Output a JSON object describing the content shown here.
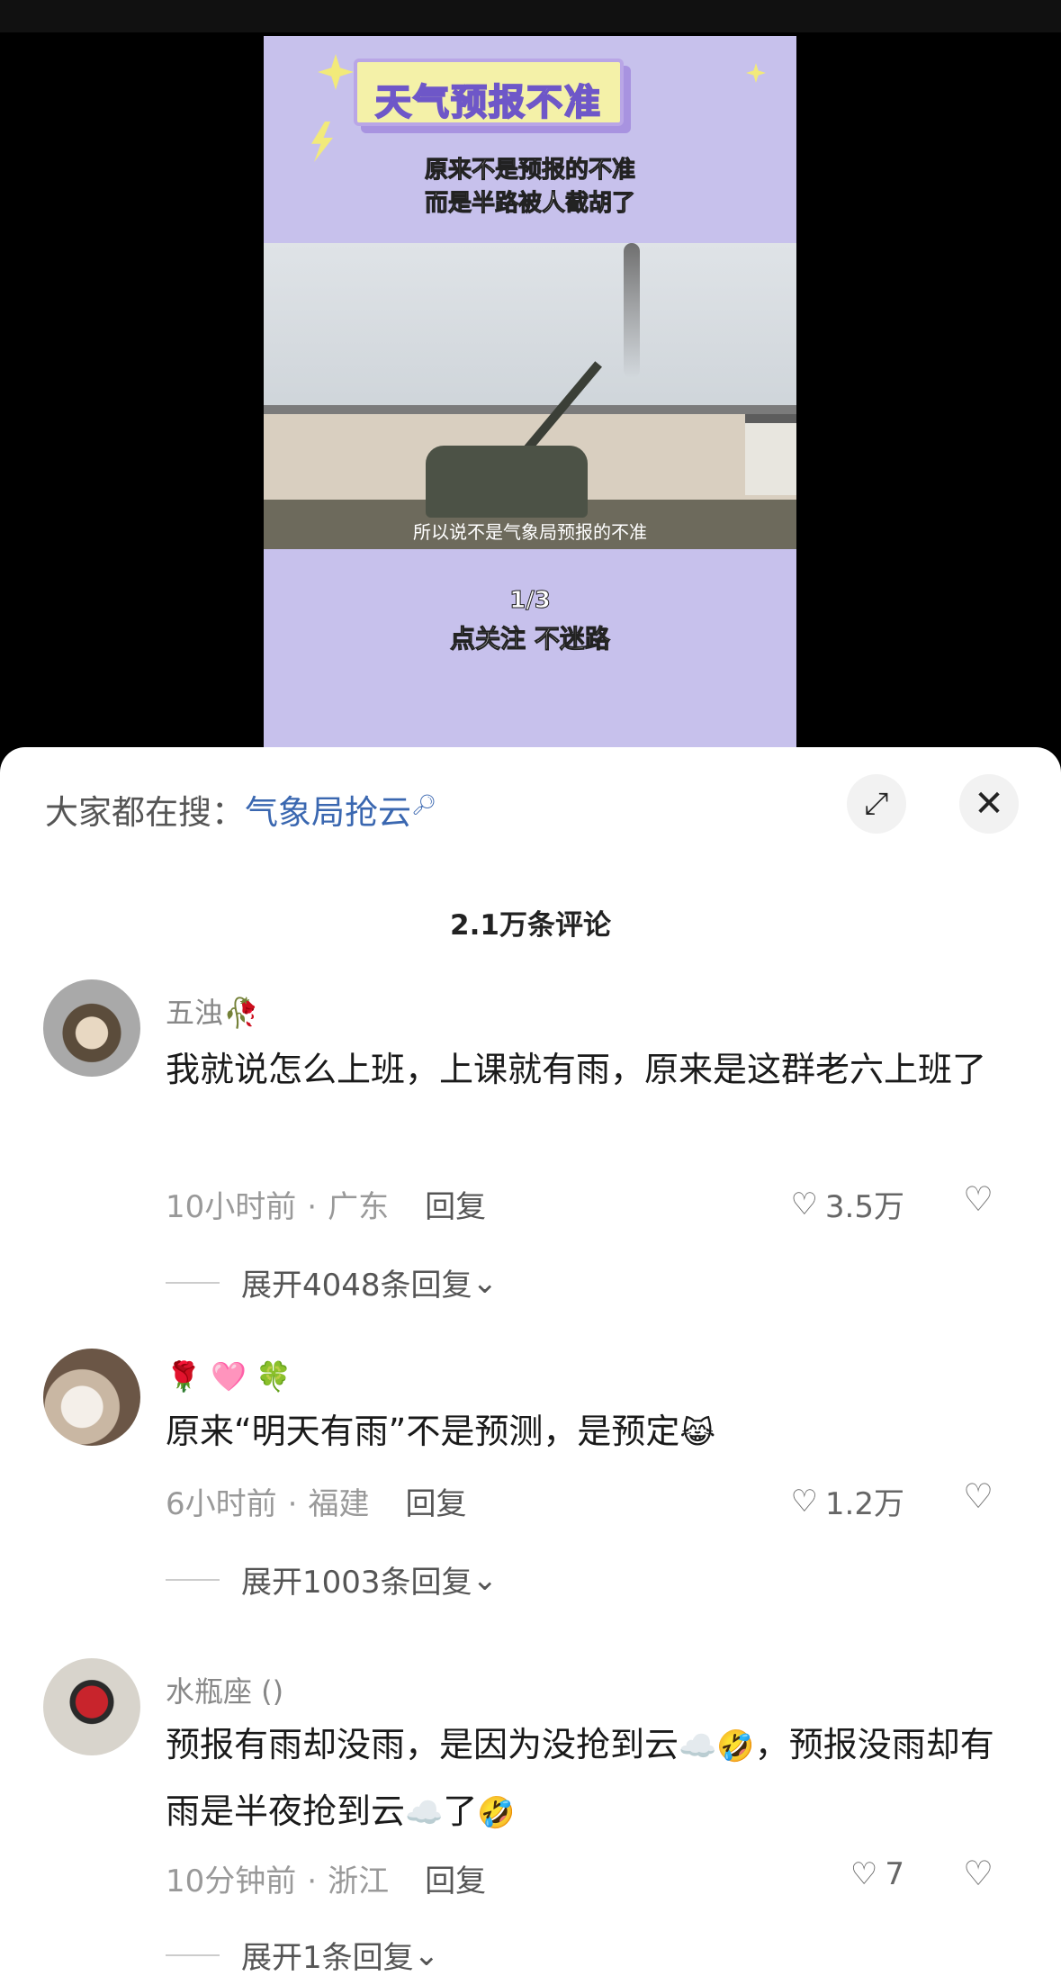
{
  "video": {
    "banner_title": "天气预报不准",
    "subtitle_line1": "原来不是预报的不准",
    "subtitle_line2": "而是半路被人截胡了",
    "caption": "所以说不是气象局预报的不准",
    "page_counter": "1/3",
    "follow_text": "点关注 不迷路"
  },
  "sheet": {
    "search_prefix": "大家都在搜：",
    "search_term": "气象局抢云",
    "search_icon": "search-icon",
    "comment_count": "2.1万条评论",
    "expand_icon": "expand-icon",
    "close_icon": "close-icon"
  },
  "comments": [
    {
      "name": "五浊",
      "name_icon": "flower-icon",
      "text": "我就说怎么上班，上课就有雨，原来是这群老六上班了",
      "time": "10小时前",
      "location": "广东",
      "reply_label": "回复",
      "likes": "3.5万",
      "expand_label": "展开4048条回复"
    },
    {
      "name": "🌹 🩷 🍀",
      "text": "原来“明天有雨”不是预测，是预定",
      "text_emoji": "😹",
      "time": "6小时前",
      "location": "福建",
      "reply_label": "回复",
      "likes": "1.2万",
      "expand_label": "展开1003条回复"
    },
    {
      "name": "水瓶座 ()",
      "text_part1": "预报有雨却没雨，是因为没抢到云",
      "text_emoji1": "☁️🤣",
      "text_part2": "，预报没雨却有雨是半夜抢到云",
      "text_emoji2": "☁️",
      "text_part3": "了",
      "text_emoji3": "🤣",
      "time": "10分钟前",
      "location": "浙江",
      "reply_label": "回复",
      "likes": "7",
      "expand_label": "展开1条回复"
    }
  ]
}
